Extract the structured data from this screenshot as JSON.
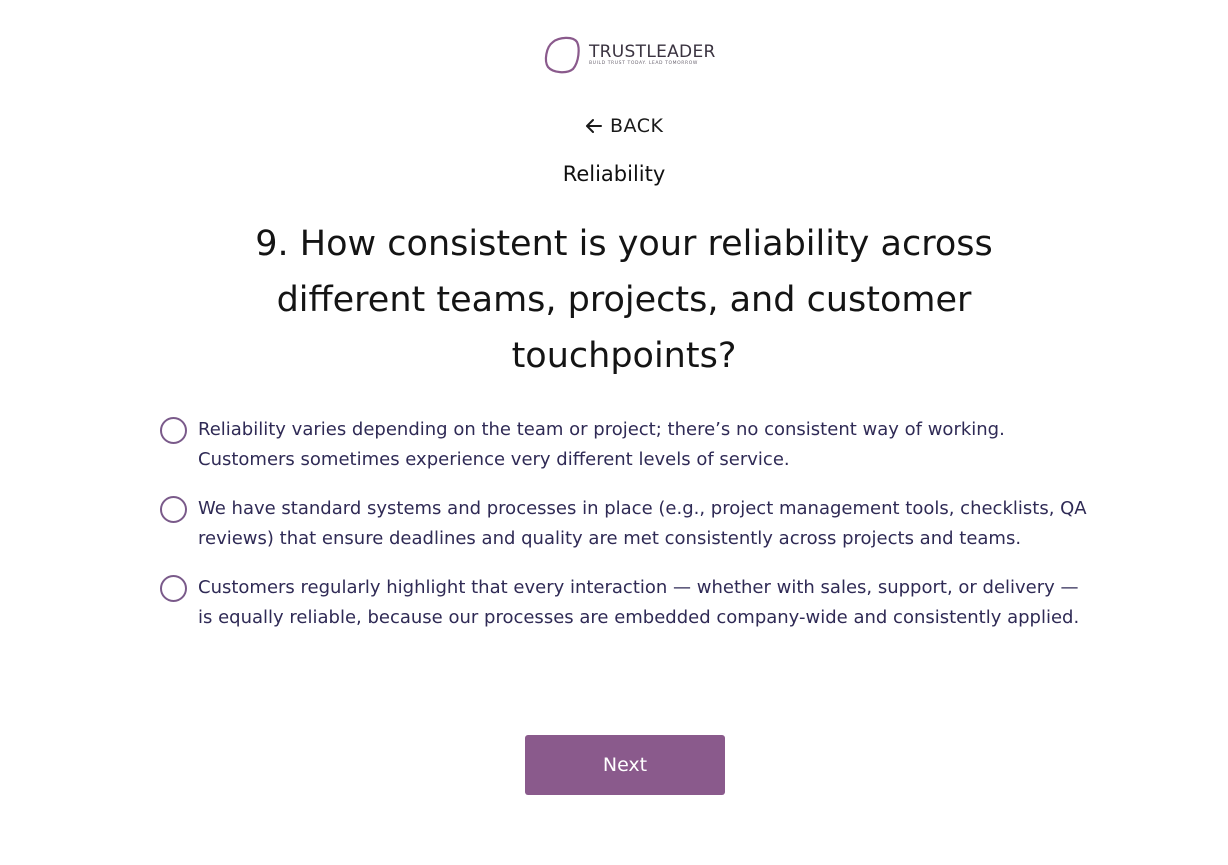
{
  "brand": {
    "name": "TRUSTLEADER",
    "tagline": "BUILD TRUST TODAY. LEAD TOMORROW",
    "accent_color": "#8a5a8c"
  },
  "nav": {
    "back_label": "BACK",
    "back_icon": "arrow-left-icon"
  },
  "section": {
    "category": "Reliability"
  },
  "question": {
    "text": "9. How consistent is your reliability across different teams, projects, and customer touchpoints?"
  },
  "options": [
    {
      "label": "Reliability varies depending on the team or project; there’s no consistent way of working. Customers sometimes experience very different levels of service."
    },
    {
      "label": "We have standard systems and processes in place (e.g., project management tools, checklists, QA reviews) that ensure deadlines and quality are met consistently across projects and teams."
    },
    {
      "label": "Customers regularly highlight that every interaction — whether with sales, support, or delivery — is equally reliable, because our processes are embedded company-wide and consistently applied."
    }
  ],
  "actions": {
    "next_label": "Next"
  }
}
